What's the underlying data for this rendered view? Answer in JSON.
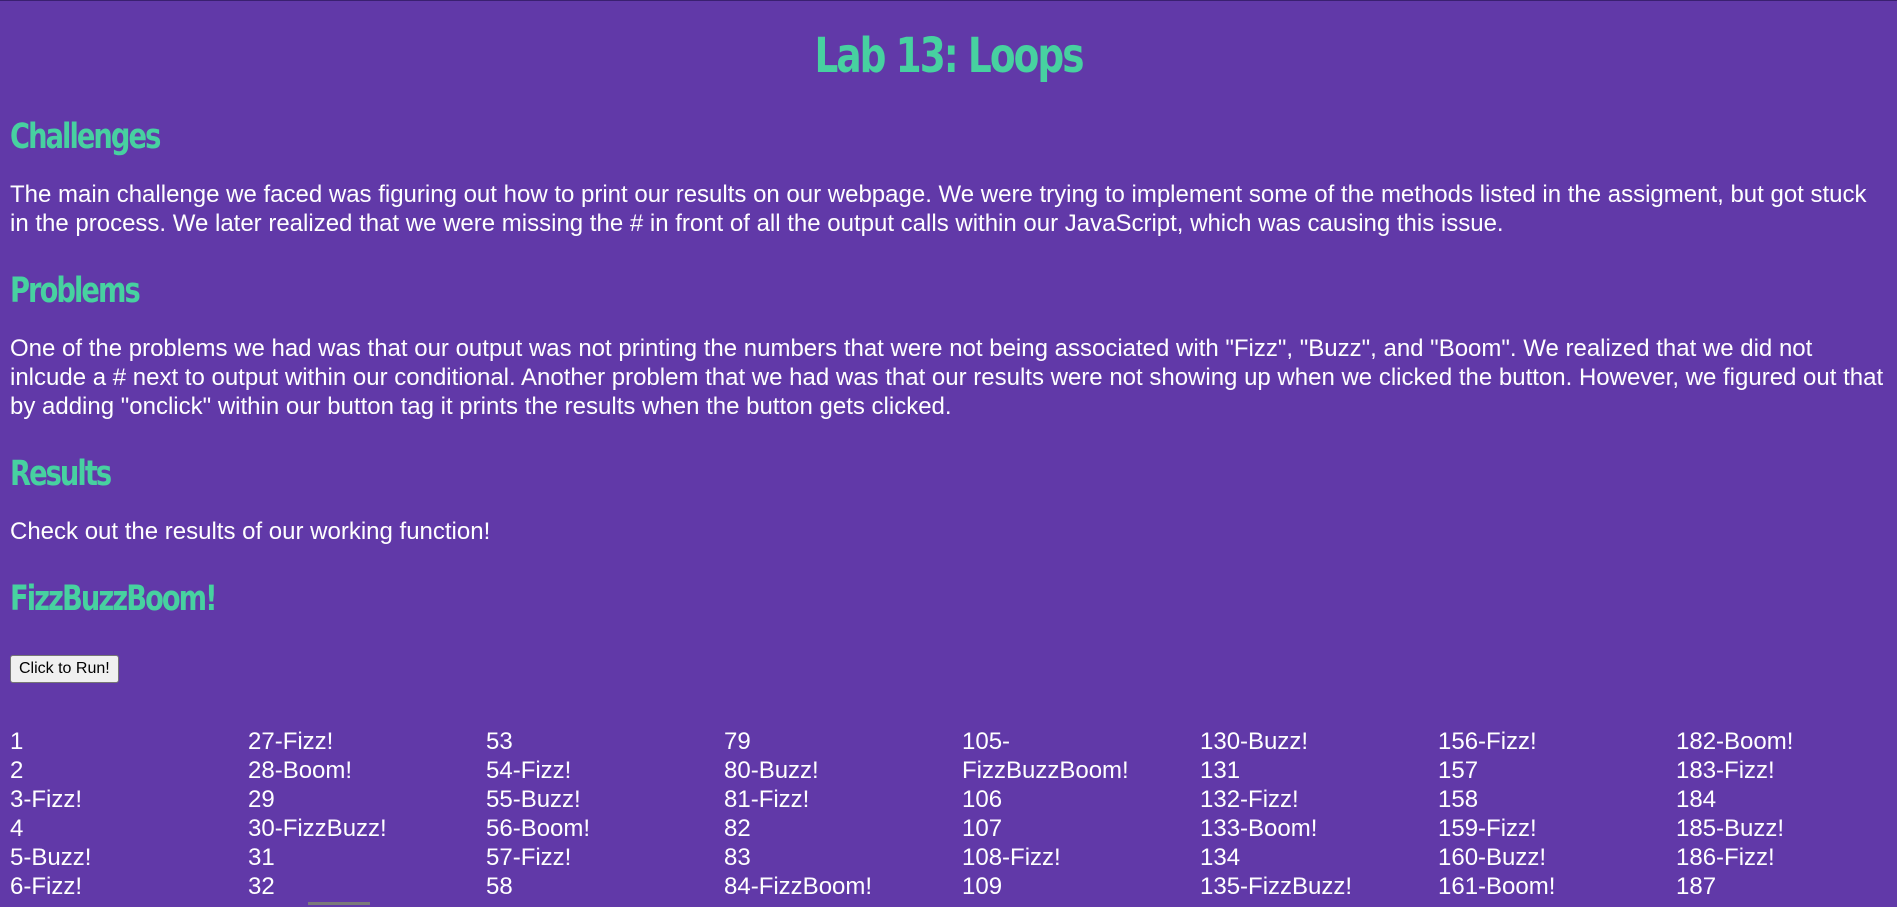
{
  "page": {
    "title": "Lab 13: Loops",
    "challenges": {
      "heading": "Challenges",
      "text": "The main challenge we faced was figuring out how to print our results on our webpage. We were trying to implement some of the methods listed in the assigment, but got stuck in the process. We later realized that we were missing the # in front of all the output calls within our JavaScript, which was causing this issue."
    },
    "problems": {
      "heading": "Problems",
      "text": "One of the problems we had was that our output was not printing the numbers that were not being associated with \"Fizz\", \"Buzz\", and \"Boom\". We realized that we did not inlcude a # next to output within our conditional. Another problem that we had was that our results were not showing up when we clicked the button. However, we figured out that by adding \"onclick\" within our button tag it prints the results when the button gets clicked."
    },
    "results": {
      "heading": "Results",
      "text": "Check out the results of our working function!"
    },
    "fizzbuzzboom": {
      "heading": "FizzBuzzBoom!",
      "button_label": "Click to Run!"
    }
  },
  "output_columns": [
    [
      "1",
      "2",
      "3-Fizz!",
      "4",
      "5-Buzz!",
      "6-Fizz!"
    ],
    [
      "27-Fizz!",
      "28-Boom!",
      "29",
      "30-FizzBuzz!",
      "31",
      "32"
    ],
    [
      "53",
      "54-Fizz!",
      "55-Buzz!",
      "56-Boom!",
      "57-Fizz!",
      "58"
    ],
    [
      "79",
      "80-Buzz!",
      "81-Fizz!",
      "82",
      "83",
      "84-FizzBoom!"
    ],
    [
      "105-",
      "FizzBuzzBoom!",
      "106",
      "107",
      "108-Fizz!",
      "109"
    ],
    [
      "130-Buzz!",
      "131",
      "132-Fizz!",
      "133-Boom!",
      "134",
      "135-FizzBuzz!"
    ],
    [
      "156-Fizz!",
      "157",
      "158",
      "159-Fizz!",
      "160-Buzz!",
      "161-Boom!"
    ],
    [
      "182-Boom!",
      "183-Fizz!",
      "184",
      "185-Buzz!",
      "186-Fizz!",
      "187"
    ]
  ],
  "colors": {
    "background": "#6139a8",
    "heading": "#47d1a0",
    "text": "#ffffff"
  }
}
